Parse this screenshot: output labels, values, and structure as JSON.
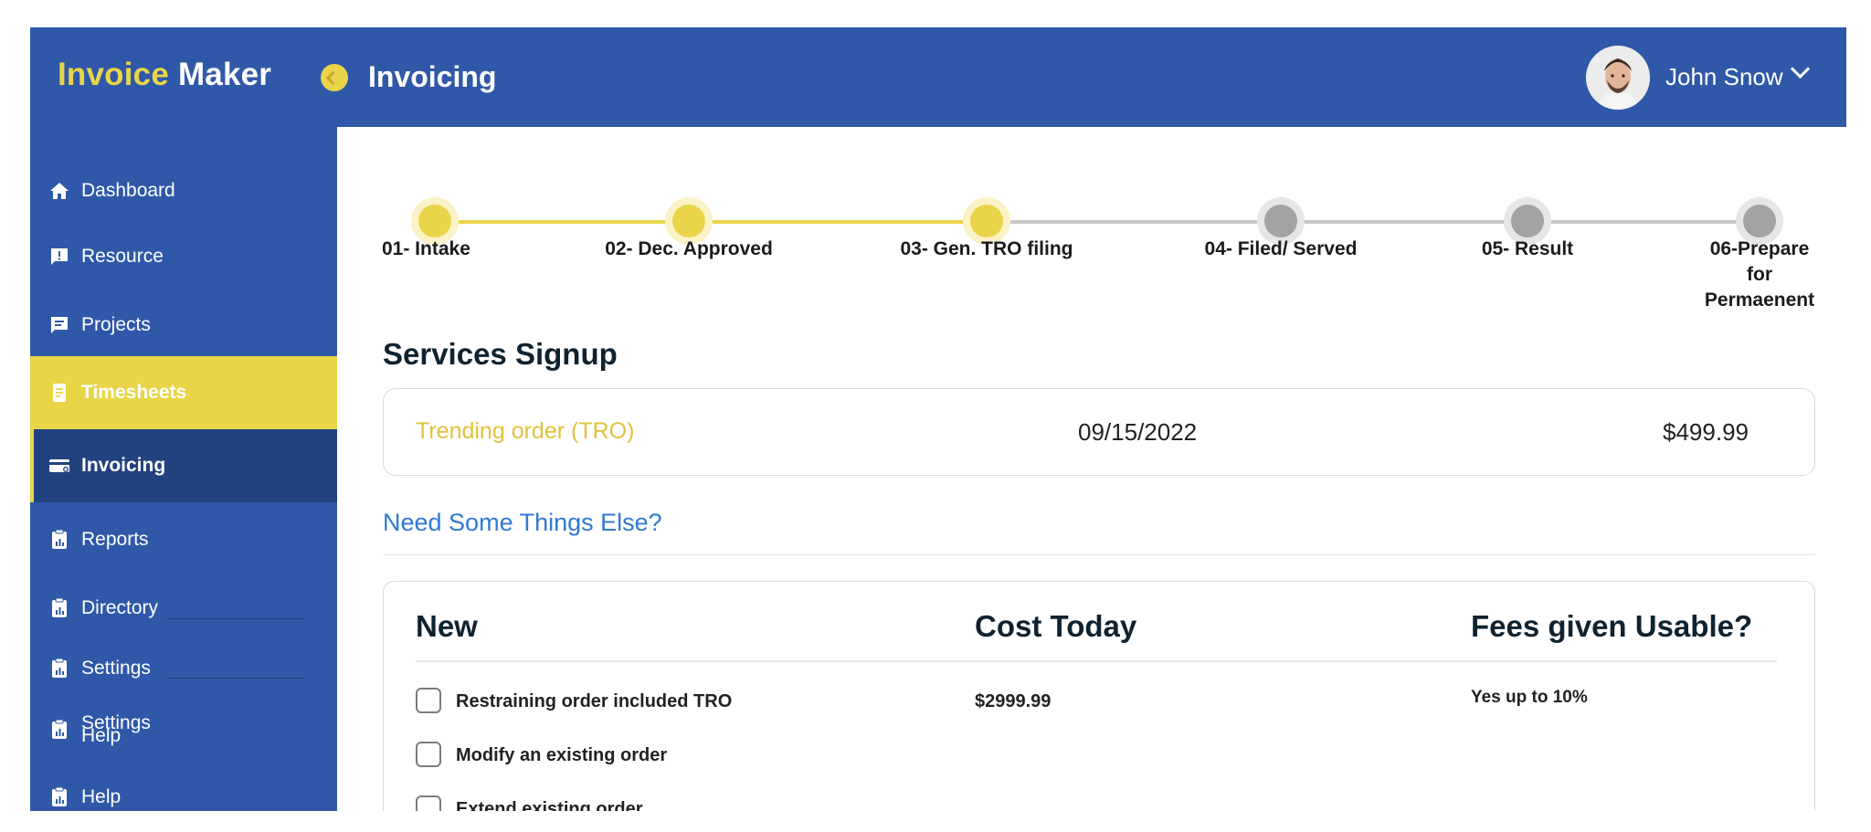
{
  "header": {
    "brand_part1": "Invoice",
    "brand_part2": "Maker",
    "section_title": "Invoicing",
    "user_name": "John Snow"
  },
  "sidebar": {
    "items": [
      {
        "label": "Dashboard",
        "icon": "home-icon"
      },
      {
        "label": "Resource",
        "icon": "alert-message-icon"
      },
      {
        "label": "Projects",
        "icon": "chat-message-icon"
      },
      {
        "label": "Timesheets",
        "icon": "document-icon"
      },
      {
        "label": "Invoicing",
        "icon": "credit-card-icon"
      },
      {
        "label": "Reports",
        "icon": "clipboard-chart-icon"
      },
      {
        "label": "Directory",
        "icon": "clipboard-chart-icon"
      },
      {
        "label": "Settings",
        "icon": "clipboard-chart-icon"
      },
      {
        "label": "Settings",
        "icon": "clipboard-chart-icon"
      },
      {
        "label": "Help",
        "icon": "clipboard-chart-icon"
      },
      {
        "label": "Help",
        "icon": "clipboard-chart-icon"
      }
    ]
  },
  "progress": {
    "steps": [
      {
        "label": "01- Intake",
        "status": "done"
      },
      {
        "label": "02- Dec. Approved",
        "status": "done"
      },
      {
        "label": "03- Gen. TRO filing",
        "status": "done"
      },
      {
        "label": "04- Filed/ Served",
        "status": "pending"
      },
      {
        "label": "05- Result",
        "status": "pending"
      },
      {
        "label": "06-Prepare for Permaenent",
        "status": "pending"
      }
    ]
  },
  "services_signup": {
    "title": "Services Signup",
    "order": {
      "name": "Trending order (TRO)",
      "date": "09/15/2022",
      "price": "$499.99"
    }
  },
  "need_link": "Need Some Things Else?",
  "services_table": {
    "headers": {
      "new": "New",
      "cost": "Cost Today",
      "fees": "Fees given Usable?"
    },
    "rows": [
      {
        "label": "Restraining order included TRO",
        "cost": "$2999.99",
        "fee": "Yes up to 10%"
      },
      {
        "label": "Modify an existing order",
        "cost": "",
        "fee": ""
      },
      {
        "label": "Extend existing order",
        "cost": "",
        "fee": ""
      }
    ]
  },
  "colors": {
    "primary_blue": "#3058a8",
    "accent_yellow": "#e9d548",
    "active_nav_dark": "#22417f",
    "link_blue": "#2f79d4",
    "pending_grey": "#a3a3a3"
  }
}
